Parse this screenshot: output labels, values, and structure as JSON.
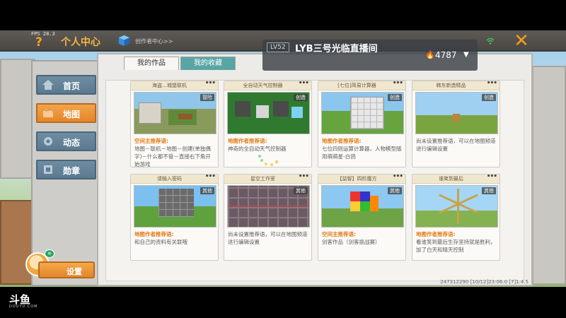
{
  "hud": {
    "fps": "FPS 28.3"
  },
  "header": {
    "help_icon": "?",
    "title": "个人中心",
    "creator_link": "创作者中心>>",
    "close_icon": "✕"
  },
  "sidebar": {
    "items": [
      {
        "label": "首页",
        "icon": "home-icon"
      },
      {
        "label": "地图",
        "icon": "map-icon"
      },
      {
        "label": "动态",
        "icon": "feed-icon"
      },
      {
        "label": "勋章",
        "icon": "medal-icon"
      }
    ],
    "settings_label": "设置"
  },
  "tabs": [
    {
      "label": "我的作品"
    },
    {
      "label": "我的收藏"
    }
  ],
  "more_label": "•••",
  "cards": [
    {
      "title": "海盗…城堡联机",
      "tag": "冒险",
      "rec": "空间主推荐语:",
      "desc": "地图－联机－地图－创建(单独偶字)－什么都不管－直接右下角开始游戏"
    },
    {
      "title": "全自动天气控制器",
      "tag": "创造",
      "rec": "地图作者推荐语:",
      "desc": "神奇的全自动天气控制器"
    },
    {
      "title": "[七位]简易计算器",
      "tag": "创造",
      "rec": "地图作者推荐语:",
      "desc": "七位四则运算计算器，人物模型随用萌萌星-白鸽"
    },
    {
      "title": "韩东新造精品",
      "tag": "创造",
      "rec": "",
      "desc": "尚未设置推荐语，可以在地图频道进行编辑设置"
    },
    {
      "title": "请输入密码",
      "tag": "其他",
      "rec": "地图作者推荐语:",
      "desc": "和自己的资料有关联哦"
    },
    {
      "title": "星空工作室",
      "tag": "其他",
      "rec": "",
      "desc": "尚未设置推荐语，可以在地图频道进行编辑设置"
    },
    {
      "title": "【益智】四阶魔方",
      "tag": "其他",
      "rec": "空间主推荐语:",
      "desc": "剑客作品（剑客挑战赛）"
    },
    {
      "title": "谁笑到最后",
      "tag": "其他",
      "rec": "地图作者推荐语:",
      "desc": "看谁笑到最后生存坚持就是胜利，加了白天和晴天控制"
    }
  ],
  "footer": {
    "ids": "247312290    [10/12]23:06.0    [7]1.4.5"
  },
  "live": {
    "level": "LV52",
    "streamer": "LYB三号光临直播间",
    "hot_icon": "🔥",
    "hot": "4787",
    "arrow": "▼"
  },
  "watermark": {
    "brand": "斗鱼",
    "sub": "DOUYU.COM"
  }
}
